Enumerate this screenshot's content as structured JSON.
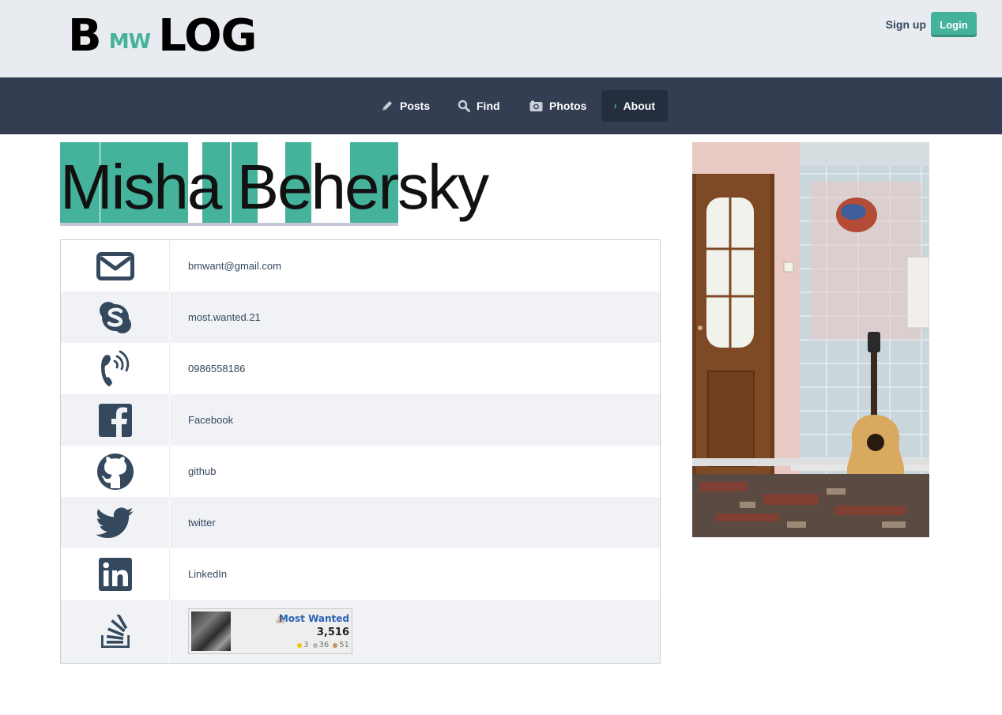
{
  "header": {
    "logo_big_1": "B",
    "logo_small": "MW",
    "logo_big_2": "LOG",
    "signup_label": "Sign up",
    "login_label": "Login"
  },
  "nav": {
    "items": [
      {
        "label": "Posts",
        "icon": "pencil-icon"
      },
      {
        "label": "Find",
        "icon": "search-icon"
      },
      {
        "label": "Photos",
        "icon": "camera-icon"
      },
      {
        "label": "About",
        "icon": "person-icon",
        "active": true
      }
    ]
  },
  "profile": {
    "name": "Misha Behersky"
  },
  "contacts": [
    {
      "icon": "envelope-icon",
      "text": "bmwant@gmail.com"
    },
    {
      "icon": "skype-icon",
      "text": "most.wanted.21"
    },
    {
      "icon": "phone-icon",
      "text": "0986558186"
    },
    {
      "icon": "facebook-icon",
      "text": "Facebook"
    },
    {
      "icon": "github-icon",
      "text": "github"
    },
    {
      "icon": "twitter-icon",
      "text": "twitter"
    },
    {
      "icon": "linkedin-icon",
      "text": "LinkedIn"
    },
    {
      "icon": "stackoverflow-icon",
      "text": ""
    }
  ],
  "stackoverflow_flair": {
    "name": "Most Wanted",
    "reputation": "3,516",
    "gold": "3",
    "silver": "36",
    "bronze": "51"
  },
  "colors": {
    "accent": "#45b39c",
    "navbar": "#343e53",
    "topbar": "#e8ebef",
    "text": "#34495e"
  }
}
